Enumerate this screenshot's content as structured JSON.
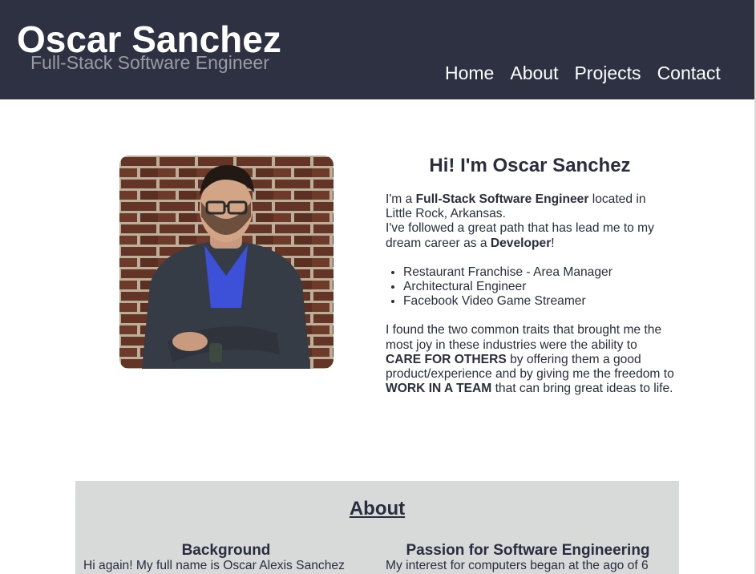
{
  "header": {
    "name": "Oscar Sanchez",
    "tagline": "Full-Stack Software Engineer",
    "nav": [
      "Home",
      "About",
      "Projects",
      "Contact"
    ]
  },
  "intro": {
    "heading": "Hi! I'm Oscar Sanchez",
    "p1_a": "I'm a ",
    "p1_bold": "Full-Stack Software Engineer",
    "p1_b": " located in Little Rock, Arkansas.",
    "p1_c": "I've followed a great path that has lead me to my dream career as a ",
    "p1_bold2": "Developer",
    "p1_d": "!",
    "jobs": [
      "Restaurant Franchise - Area Manager",
      "Architectural Engineer",
      "Facebook Video Game Streamer"
    ],
    "p2_a": "I found the two common traits that brought me the most joy in these industries were the ability to ",
    "p2_bold1": "CARE FOR OTHERS",
    "p2_b": " by offering them a good product/experience and by giving me the freedom to ",
    "p2_bold2": "WORK IN A TEAM",
    "p2_c": " that can bring great ideas to life."
  },
  "about": {
    "title": "About",
    "background_title": "Background",
    "background_text": "Hi again! My full name is Oscar Alexis Sanchez",
    "passion_title": "Passion for Software Engineering",
    "passion_text": "My interest for computers began at the ago of 6"
  },
  "colors": {
    "header_bg": "#2d3142",
    "text": "#2a2d3e",
    "tagline": "#9a9ba3",
    "about_bg": "#d8dada"
  }
}
